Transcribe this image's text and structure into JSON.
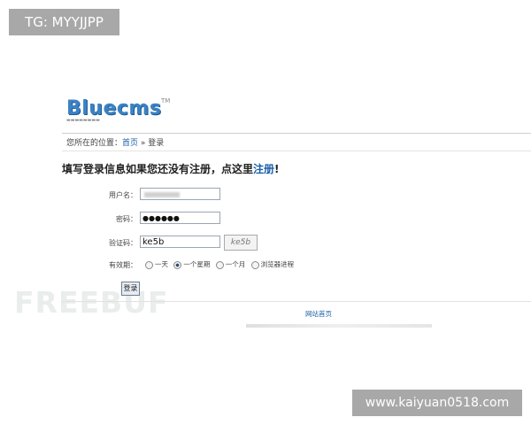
{
  "overlay": {
    "tg_label": "TG: MYYJJPP",
    "site_url": "www.kaiyuan0518.com",
    "watermark": "FREEBUF"
  },
  "brand": {
    "logo_text": "Bluecms",
    "logo_tm": "TM"
  },
  "breadcrumb": {
    "prefix": "您所在的位置：",
    "home": "首页",
    "sep": " » ",
    "current": "登录"
  },
  "form": {
    "heading_text": "填写登录信息如果您还没有注册，点这里",
    "heading_link": "注册",
    "heading_tail": "!",
    "username_label": "用户名：",
    "password_label": "密码：",
    "password_value": "●●●●●●",
    "captcha_label": "验证码：",
    "captcha_value": "ke5b",
    "captcha_image_text": "ke5b",
    "validity_label": "有效期：",
    "validity_options": [
      "一天",
      "一个星期",
      "一个月",
      "浏览器进程"
    ],
    "validity_selected": 1,
    "submit_label": "登录"
  },
  "footer": {
    "home_link": "网站首页"
  }
}
